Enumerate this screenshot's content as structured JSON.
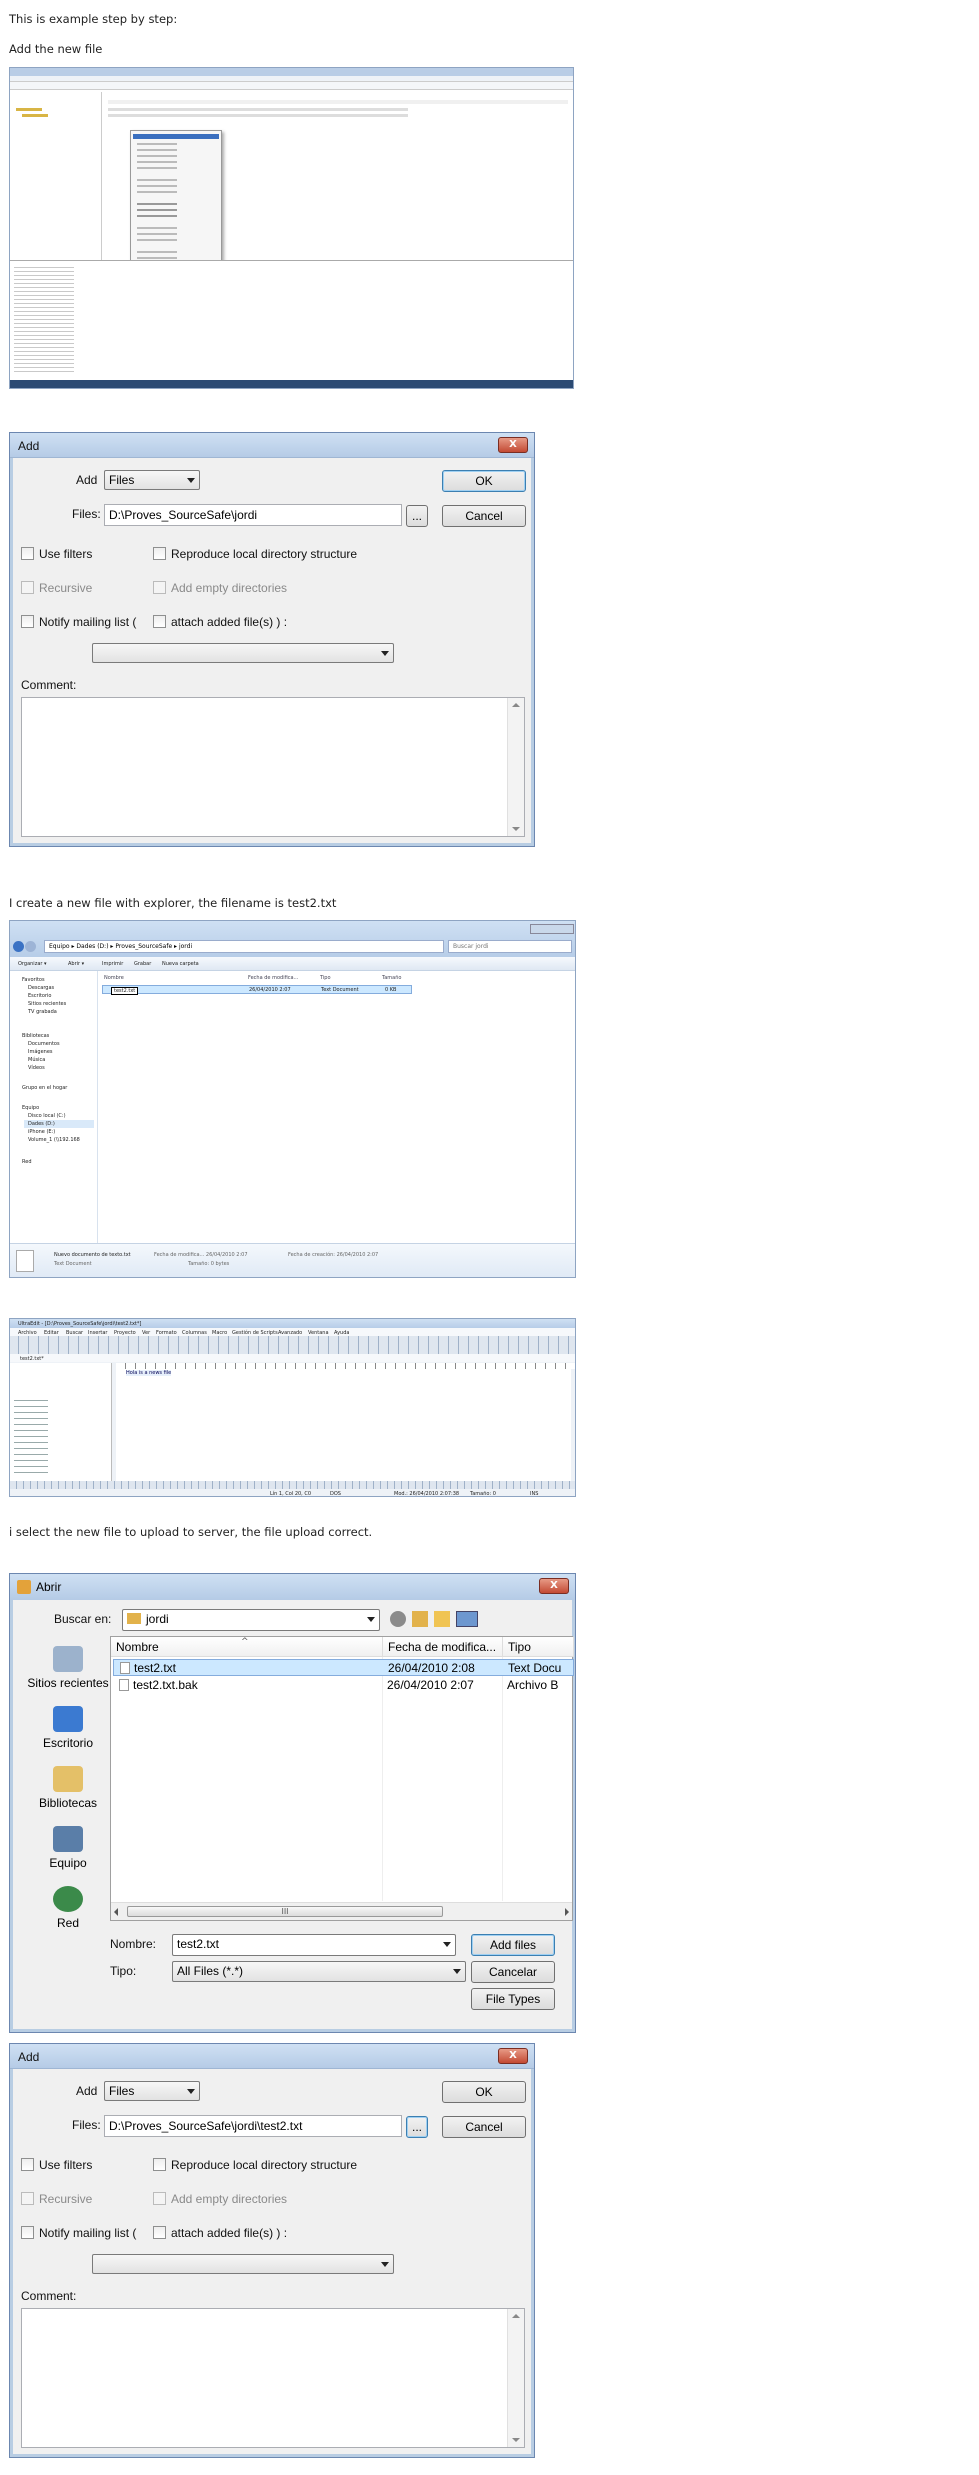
{
  "intro": {
    "line1": "This is example step by step:",
    "line2": "Add the new file"
  },
  "captions": {
    "explorer": "I create a new file with explorer, the filename is test2.txt",
    "upload": "i select the new file to upload to server, the file upload correct."
  },
  "add_dialog_1": {
    "title": "Add",
    "close": "X",
    "add_label": "Add",
    "add_value": "Files",
    "files_label": "Files:",
    "files_value": "D:\\Proves_SourceSafe\\jordi",
    "browse": "...",
    "ok": "OK",
    "cancel": "Cancel",
    "use_filters": "Use filters",
    "reproduce": "Reproduce local directory structure",
    "recursive": "Recursive",
    "add_empty": "Add empty directories",
    "notify": "Notify mailing list (",
    "attach": "attach added file(s) ) :",
    "comment": "Comment:"
  },
  "add_dialog_2": {
    "title": "Add",
    "close": "X",
    "add_label": "Add",
    "add_value": "Files",
    "files_label": "Files:",
    "files_value": "D:\\Proves_SourceSafe\\jordi\\test2.txt",
    "browse": "...",
    "ok": "OK",
    "cancel": "Cancel",
    "use_filters": "Use filters",
    "reproduce": "Reproduce local directory structure",
    "recursive": "Recursive",
    "add_empty": "Add empty directories",
    "notify": "Notify mailing list (",
    "attach": "attach added file(s) ) :",
    "comment": "Comment:"
  },
  "explorer": {
    "breadcrumb": "Equipo ▸ Dades (D:) ▸ Proves_SourceSafe ▸ jordi",
    "search": "Buscar jordi",
    "toolbar": [
      "Organizar ▾",
      "Abrir ▾",
      "Imprimir",
      "Grabar",
      "Nueva carpeta"
    ],
    "nav": [
      "Favoritos",
      "Descargas",
      "Escritorio",
      "Sitios recientes",
      "TV grabada",
      "",
      "Bibliotecas",
      "Documentos",
      "Imágenes",
      "Música",
      "Vídeos",
      "",
      "Grupo en el hogar",
      "",
      "Equipo",
      "Disco local (C:)",
      "Dades (D:)",
      "iPhone (E:)",
      "Volume_1 (\\\\192.168",
      "",
      "Red"
    ],
    "columns": [
      "Nombre",
      "Fecha de modifica...",
      "Tipo",
      "Tamaño"
    ],
    "file": {
      "name": "test2.txt",
      "date": "26/04/2010 2:07",
      "type": "Text Document",
      "size": "0 KB"
    },
    "details_name": "Nuevo documento de texto.txt",
    "details_type": "Text Document",
    "details_mod": "Fecha de modifica... 26/04/2010 2:07",
    "details_size": "Tamaño: 0 bytes",
    "details_created": "Fecha de creación: 26/04/2010 2:07"
  },
  "ultraedit": {
    "title": "UltraEdit - [D:\\Proves_SourceSafe\\jordi\\test2.txt*]",
    "menu": [
      "Archivo",
      "Editar",
      "Buscar",
      "Insertar",
      "Proyecto",
      "Ver",
      "Formato",
      "Columnas",
      "Macro",
      "Gestión de Scripts",
      "Avanzado",
      "Ventana",
      "Ayuda"
    ],
    "tab": "test2.txt*",
    "content": "Hola is a news file",
    "status": [
      "Lín 1, Col 20, C0",
      "DOS",
      "Mod.: 26/04/2010 2:07:38",
      "Tamaño: 0",
      "INS"
    ]
  },
  "abrir": {
    "title": "Abrir",
    "close": "X",
    "lookin_label": "Buscar en:",
    "lookin_value": "jordi",
    "places": [
      "Sitios recientes",
      "Escritorio",
      "Bibliotecas",
      "Equipo",
      "Red"
    ],
    "columns": [
      "Nombre",
      "Fecha de modifica...",
      "Tipo"
    ],
    "files": [
      {
        "name": "test2.txt",
        "date": "26/04/2010 2:08",
        "type": "Text Docu"
      },
      {
        "name": "test2.txt.bak",
        "date": "26/04/2010 2:07",
        "type": "Archivo B"
      }
    ],
    "name_label": "Nombre:",
    "name_value": "test2.txt",
    "type_label": "Tipo:",
    "type_value": "All Files (*.*)",
    "add_files": "Add files",
    "cancel": "Cancelar",
    "file_types": "File Types",
    "hscroll": "III"
  },
  "colors": {
    "title_bar": "#c4d7ee",
    "close_red": "#c94a33",
    "selected_row": "#cce8ff"
  }
}
